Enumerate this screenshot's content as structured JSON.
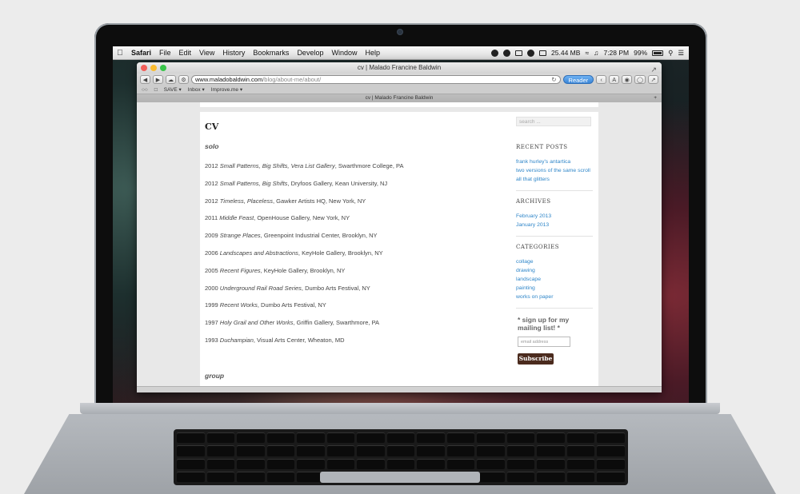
{
  "menubar": {
    "app": "Safari",
    "items": [
      "File",
      "Edit",
      "View",
      "History",
      "Bookmarks",
      "Develop",
      "Window",
      "Help"
    ],
    "memory": "25.44 MB",
    "time": "7:28 PM",
    "battery": "99%"
  },
  "window": {
    "title": "cv | Malado Francine Baldwin",
    "url_host": "www.maladobaldwin.com",
    "url_path": "/blog/about-me/about/",
    "reader_label": "Reader",
    "bookmarks": [
      "SAVE ▾",
      "Inbox ▾",
      "Improve.me ▾"
    ],
    "tab_title": "cv | Malado Francine Baldwin",
    "tab_plus": "+"
  },
  "page": {
    "title": "CV",
    "sections": [
      {
        "heading": "solo",
        "entries": [
          {
            "year": "2012",
            "work": "Small Patterns, Big Shifts, Vera List Gallery",
            "rest": ", Swarthmore College, PA"
          },
          {
            "year": "2012",
            "work": "Small Patterns, Big Shifts",
            "rest": ", Dryfoos Gallery, Kean University, NJ"
          },
          {
            "year": "2012",
            "work": "Timeless, Placeless",
            "rest": ", Gawker Artists HQ, New York, NY"
          },
          {
            "year": "2011",
            "work": "Middle Feast",
            "rest": ", OpenHouse Gallery, New York, NY"
          },
          {
            "year": "2009",
            "work": "Strange Places",
            "rest": ", Greenpoint Industrial Center, Brooklyn, NY"
          },
          {
            "year": "2006",
            "work": "Landscapes and Abstractions",
            "rest": ", KeyHole Gallery, Brooklyn, NY"
          },
          {
            "year": "2005",
            "work": "Recent Figures",
            "rest": ", KeyHole Gallery, Brooklyn, NY"
          },
          {
            "year": "2000",
            "work": "Underground Rail Road Series",
            "rest": ", Dumbo Arts Festival, NY"
          },
          {
            "year": "1999",
            "work": "Recent Works",
            "rest": ", Dumbo Arts Festival, NY"
          },
          {
            "year": "1997",
            "work": "Holy Grail and Other Works",
            "rest": ", Griffin Gallery, Swarthmore, PA"
          },
          {
            "year": "1993",
            "work": "Duchampian",
            "rest": ", Visual Arts Center, Wheaton, MD"
          }
        ]
      },
      {
        "heading": "group",
        "entries": []
      }
    ]
  },
  "sidebar": {
    "search_placeholder": "search ...",
    "recent_posts": {
      "heading": "RECENT POSTS",
      "items": [
        "frank hurley's antartica",
        "two versions of the same scroll",
        "all that glitters"
      ]
    },
    "archives": {
      "heading": "ARCHIVES",
      "items": [
        "February 2013",
        "January 2013"
      ]
    },
    "categories": {
      "heading": "CATEGORIES",
      "items": [
        "collage",
        "drawing",
        "landscape",
        "painting",
        "works on paper"
      ]
    },
    "mailing": {
      "heading": "* sign up for my mailing list! *",
      "email_placeholder": "email address",
      "button": "Subscribe"
    }
  }
}
